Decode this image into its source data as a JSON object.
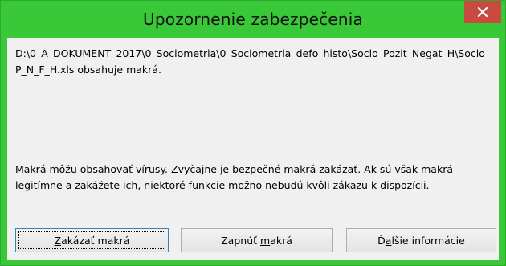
{
  "window": {
    "title": "Upozornenie zabezpečenia"
  },
  "message": {
    "path_line": "D:\\0_A_DOKUMENT_2017\\0_Sociometria\\0_Sociometria_defo_histo\\Socio_Pozit_Negat_H\\Socio_P_N_F_H.xls obsahuje makrá.",
    "warning": "Makrá môžu obsahovať vírusy. Zvyčajne je bezpečné makrá zakázať. Ak sú však makrá legitímne a zakážete ich, niektoré funkcie možno nebudú kvôli zákazu k dispozícii."
  },
  "buttons": {
    "disable_macros": {
      "before": "",
      "key": "Z",
      "after": "akázať makrá"
    },
    "enable_macros": {
      "before": "Zapnúť ",
      "key": "m",
      "after": "akrá"
    },
    "more_info": {
      "before": "Ď",
      "key": "a",
      "after": "lšie informácie"
    }
  },
  "icons": {
    "close": "close-x-icon"
  },
  "colors": {
    "title_bar": "#38c838",
    "close_button": "#c94a3e",
    "client_background": "#f0f0f0"
  }
}
